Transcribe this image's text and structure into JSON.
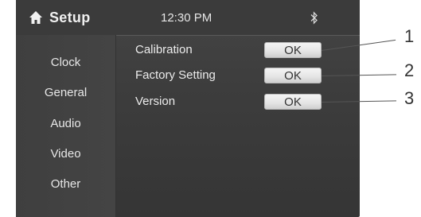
{
  "header": {
    "title": "Setup",
    "time": "12:30 PM"
  },
  "sidebar": {
    "items": [
      {
        "label": "Clock"
      },
      {
        "label": "General"
      },
      {
        "label": "Audio"
      },
      {
        "label": "Video"
      },
      {
        "label": "Other"
      }
    ]
  },
  "settings": {
    "rows": [
      {
        "label": "Calibration",
        "button": "OK"
      },
      {
        "label": "Factory Setting",
        "button": "OK"
      },
      {
        "label": "Version",
        "button": "OK"
      }
    ]
  },
  "callouts": [
    "1",
    "2",
    "3"
  ],
  "colors": {
    "screen_bg": "#3d3d3d",
    "text": "#ececec",
    "button_bg": "#e6e6e6"
  },
  "icons": {
    "home": "home-icon",
    "bluetooth": "bluetooth-icon"
  }
}
